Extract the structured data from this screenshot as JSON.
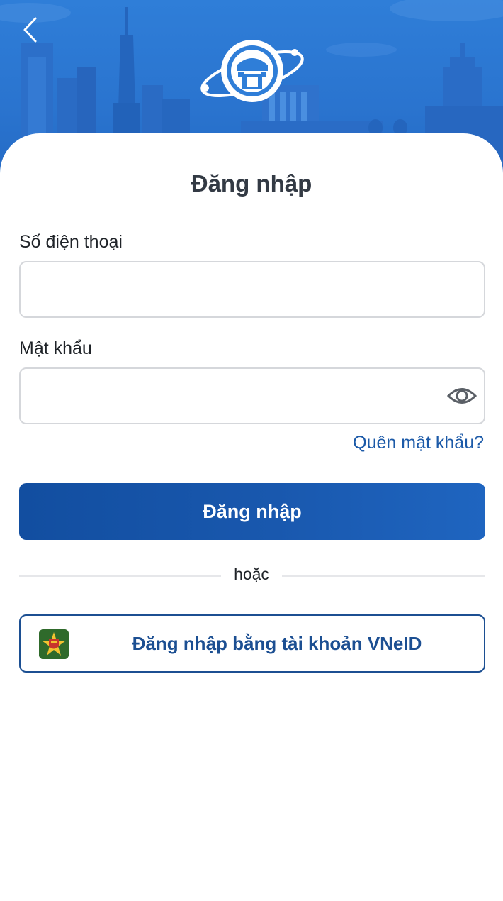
{
  "header": {
    "back_icon": "chevron-left-icon",
    "logo_icon": "hanoi-emblem-logo"
  },
  "title": "Đăng nhập",
  "phone": {
    "label": "Số điện thoại",
    "value": "",
    "placeholder": ""
  },
  "password": {
    "label": "Mật khẩu",
    "value": "",
    "placeholder": "",
    "toggle_icon": "eye-icon"
  },
  "forgot_password": "Quên mật khẩu?",
  "login_button": "Đăng nhập",
  "divider_text": "hoặc",
  "vneid": {
    "label": "Đăng nhập bằng tài khoản VNeID",
    "icon": "vneid-logo-icon"
  },
  "colors": {
    "header_blue": "#2f7ed8",
    "primary": "#1958ae",
    "link": "#1c5aa8"
  }
}
